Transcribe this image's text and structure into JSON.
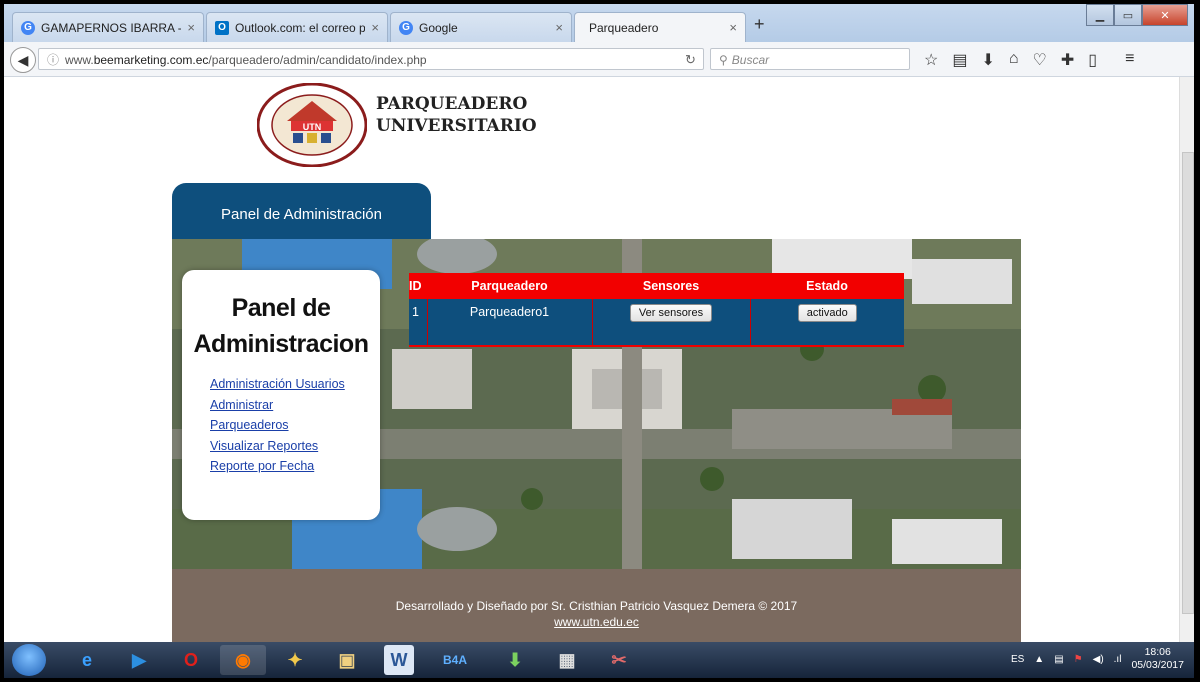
{
  "browser": {
    "tabs": [
      {
        "title": "GAMAPERNOS IBARRA - B...",
        "icon": "google-icon",
        "color": "#4285f4"
      },
      {
        "title": "Outlook.com: el correo per...",
        "icon": "outlook-icon",
        "color": "#0072c6"
      },
      {
        "title": "Google",
        "icon": "google-icon",
        "color": "#4285f4"
      },
      {
        "title": "Parqueadero",
        "icon": "none",
        "color": ""
      }
    ],
    "url_prefix": "www.",
    "url_domain": "beemarketing.com.ec",
    "url_path": "/parqueadero/admin/candidato/index.php",
    "search_placeholder": "Buscar"
  },
  "page": {
    "brand_line1": "PARQUEADERO",
    "brand_line2": "UNIVERSITARIO",
    "panel_tab": "Panel de Administración",
    "sidebar": {
      "title_line1": "Panel de",
      "title_line2": "Administracion",
      "links": [
        "Administración Usuarios",
        "Administrar",
        "Parqueaderos",
        "Visualizar Reportes",
        "Reporte por Fecha"
      ]
    },
    "table": {
      "headers": [
        "ID",
        "Parqueadero",
        "Sensores",
        "Estado"
      ],
      "rows": [
        {
          "id": "1",
          "name": "Parqueadero1",
          "sensors_button": "Ver sensores",
          "status_button": "activado"
        }
      ]
    },
    "footer": {
      "credit": "Desarrollado y Diseñado por Sr. Cristhian Patricio Vasquez Demera © 2017",
      "link": "www.utn.edu.ec"
    }
  },
  "taskbar": {
    "lang": "ES",
    "time": "18:06",
    "date": "05/03/2017"
  },
  "colors": {
    "header_red": "#f20000",
    "panel_blue": "#0e4f7d",
    "footer_brown": "#7b6a5f"
  }
}
